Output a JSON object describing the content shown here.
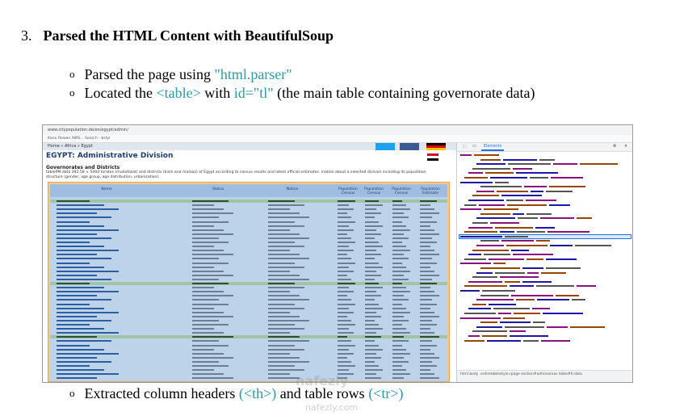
{
  "heading": {
    "number": "3.",
    "title": "Parsed the HTML Content with BeautifulSoup"
  },
  "bullets": [
    {
      "mark": "o",
      "pre": "Parsed the page using ",
      "code": "\"html.parser\"",
      "mid": "",
      "code2": "",
      "post": ""
    },
    {
      "mark": "o",
      "pre": "Located the ",
      "code": "<table>",
      "mid": " with ",
      "code2": "id=\"tl\"",
      "post": " (the main table containing governorate data)"
    }
  ],
  "last_bullet": {
    "mark": "o",
    "pre": "Extracted column headers ",
    "code": "(<th>)",
    "mid": " and table rows ",
    "code2": "(<tr>)"
  },
  "screenshot": {
    "address": "www.citypopulation.de/en/egypt/admin/",
    "bookmarks": "Kanu Rowan AWS...    Search  -  bstyl",
    "breadcrumb": "Home » Africa » Egypt",
    "page_title": "EGYPT: Administrative Division",
    "section": "Governorates and Districts",
    "desc": "tablePM.data  392.58 × 5404   torates (muhafazat) and districts (kism and markaz) of Egypt according to census results and latest official estimates.   ination about a selected division including its population structure (gender, age group, age distribution, urbanization).",
    "table_headers": [
      "Name",
      "Status",
      "Native",
      "Population Census",
      "Population Census",
      "Population Census",
      "Population Estimate"
    ],
    "devtools_tab": "Elements",
    "devtools_footer": "html  body  .entiretablestyle.rpage  section#adminareas  table#tl.data"
  },
  "watermark": {
    "line1": "nafezly",
    "line2": "nafezly.com"
  },
  "colors": {
    "code": "#2a9aa8",
    "table_bg": "#bcd3ea",
    "table_frame": "#f6c98a",
    "title_blue": "#1f3c7a"
  }
}
